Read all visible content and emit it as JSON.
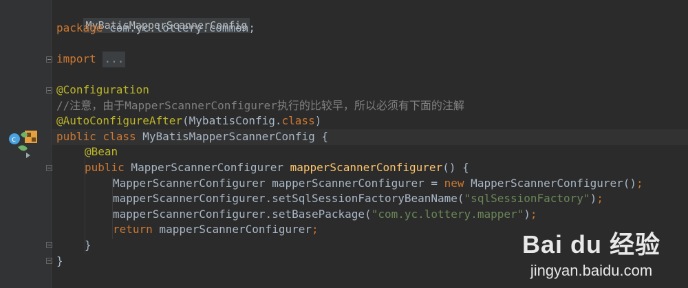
{
  "editor": {
    "breadcrumb": "MyBatisMapperScannerConfig",
    "lines": {
      "package": {
        "kw": "package",
        "rest": " com.yc.lottery.common;"
      },
      "import": {
        "kw": "import",
        "fold": "..."
      },
      "configuration": "@Configuration",
      "comment": "//注意，由于MapperScannerConfigurer执行的比较早，所以必须有下面的注解",
      "autoconfig": {
        "ann": "@AutoConfigureAfter",
        "open": "(MybatisConfig.",
        "kw": "class",
        "close": ")"
      },
      "classdecl": {
        "kw1": "public",
        "kw2": "class",
        "name": "MyBatisMapperScannerConfig",
        "brace": " {"
      },
      "bean": "@Bean",
      "methoddecl": {
        "kw": "public",
        "type": " MapperScannerConfigurer ",
        "name": "mapperScannerConfigurer",
        "rest": "() {"
      },
      "newline": {
        "prefix": "MapperScannerConfigurer mapperScannerConfigurer = ",
        "kw": "new",
        "suffix": " MapperScannerConfigurer()",
        "semi": ";"
      },
      "setsession": {
        "prefix": "mapperScannerConfigurer.setSqlSessionFactoryBeanName(",
        "str": "\"sqlSessionFactory\"",
        "suffix": ")",
        "semi": ";"
      },
      "setbase": {
        "prefix": "mapperScannerConfigurer.setBasePackage(",
        "str": "\"com.yc.lottery.mapper\"",
        "suffix": ")",
        "semi": ";"
      },
      "returnline": {
        "kw": "return",
        "rest": " mapperScannerConfigurer",
        "semi": ";"
      },
      "close1": "}",
      "close2": "}"
    }
  },
  "watermark": {
    "brand": "Bai du 经验",
    "url": "jingyan.baidu.com"
  },
  "colors": {
    "background": "#2b2b2b",
    "keyword": "#cc7832",
    "annotation": "#bbb529",
    "string": "#6a8759",
    "method": "#ffc66d",
    "comment": "#808080"
  }
}
